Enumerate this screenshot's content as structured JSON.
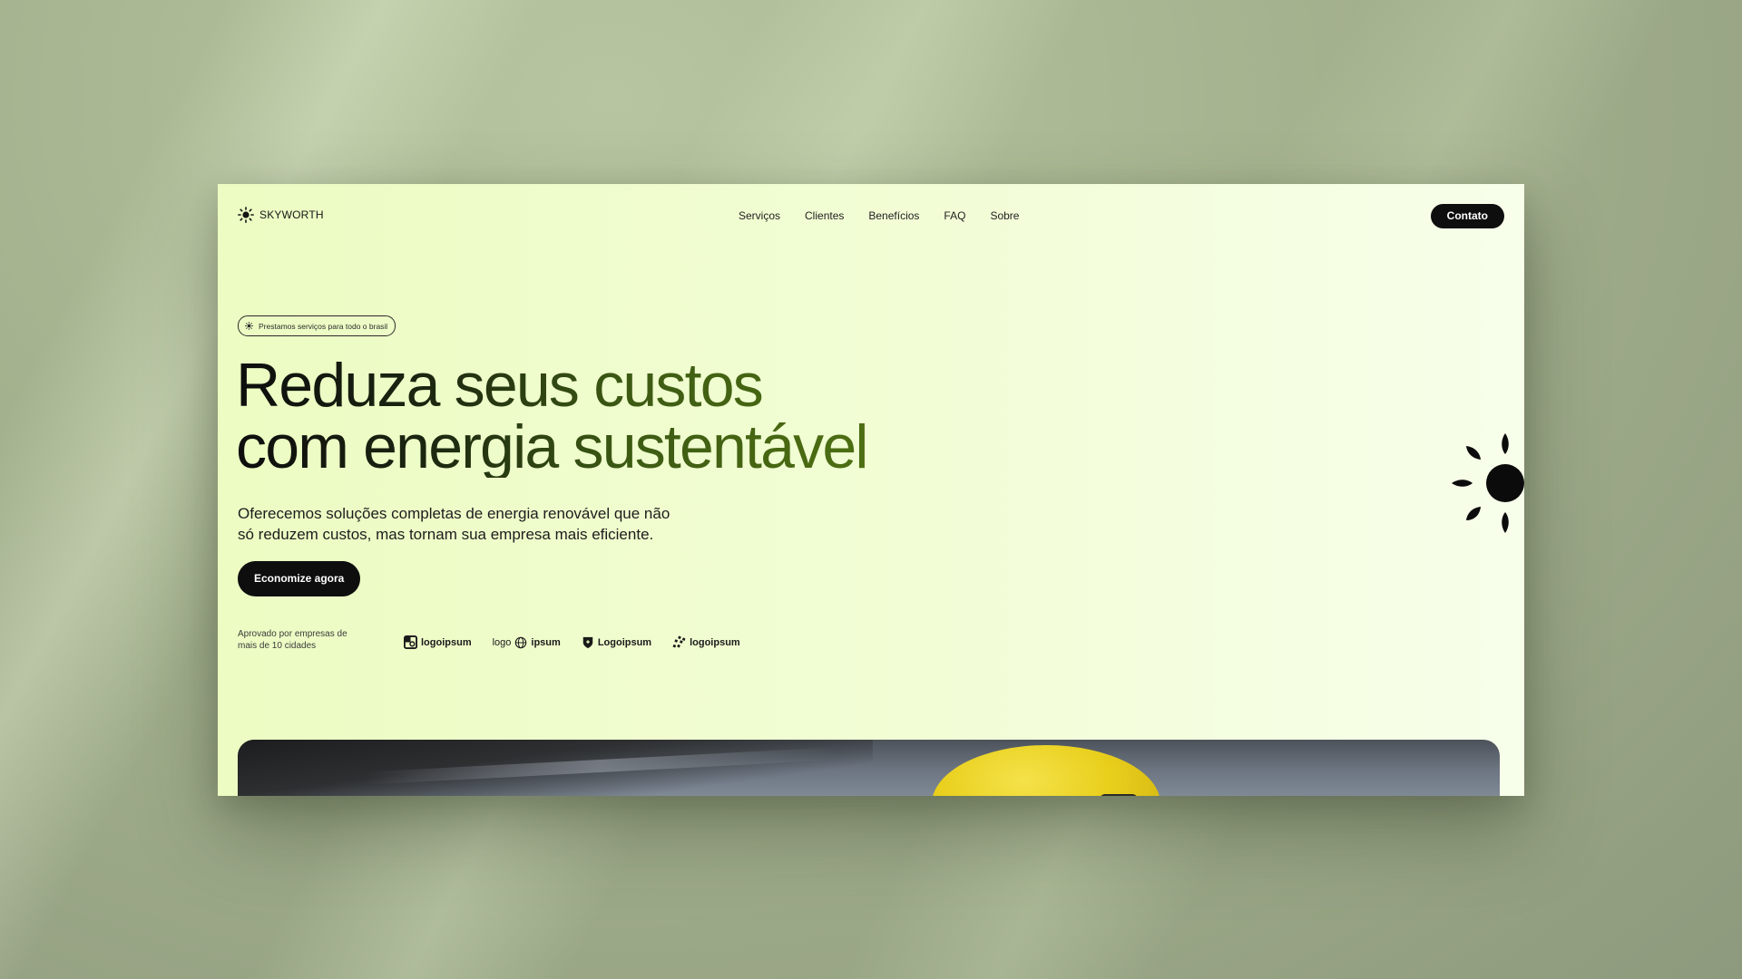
{
  "brand": {
    "name": "SKYWORTH",
    "icon": "sun-icon"
  },
  "nav": {
    "items": [
      "Serviços",
      "Clientes",
      "Benefícios",
      "FAQ",
      "Sobre"
    ],
    "contact_label": "Contato"
  },
  "hero": {
    "badge_icon": "sun-icon",
    "badge_text": "Prestamos serviços para todo o brasil",
    "headline_line1": "Reduza seus custos",
    "headline_line2": "com energia sustentável",
    "subtitle_line1": "Oferecemos soluções completas de energia renovável que não",
    "subtitle_line2": "só reduzem custos, mas tornam sua empresa mais eficiente.",
    "cta_label": "Economize agora",
    "approved_line1": "Aprovado por empresas de",
    "approved_line2": "mais de 10 cidades"
  },
  "logos": [
    {
      "text": "logoipsum",
      "icon": "square-logo-icon"
    },
    {
      "text_left": "logo",
      "text_right": "ipsum",
      "icon": "globe-logo-icon"
    },
    {
      "text": "Logoipsum",
      "icon": "shield-logo-icon"
    },
    {
      "text": "logoipsum",
      "icon": "dots-logo-icon"
    }
  ],
  "decor": {
    "sun_icon": "large-sun-icon",
    "hero_image": "worker-yellow-helmet-photo"
  },
  "colors": {
    "page_bg_start": "#ecfcc2",
    "page_bg_end": "#f7feea",
    "button_bg": "#0e0e0e",
    "headline_green": "#4d6f12",
    "helmet_yellow": "#e9cf1c"
  }
}
